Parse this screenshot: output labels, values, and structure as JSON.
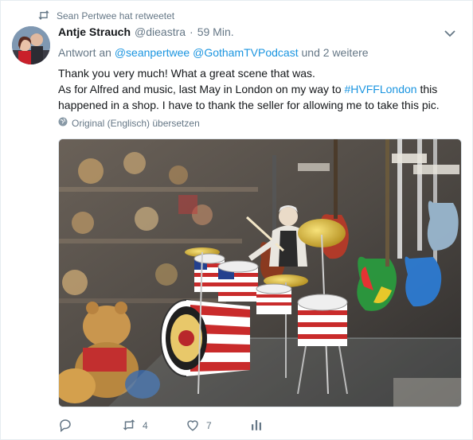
{
  "retweet_notice": "Sean Pertwee hat retweetet",
  "author": {
    "name": "Antje Strauch",
    "handle": "@diеastra",
    "separator": "·",
    "time": "59 Min."
  },
  "reply_context": {
    "prefix": "Antwort an",
    "mention1": "@seanpertwee",
    "mention2": "@GothamTVPodcast",
    "suffix": "und 2 weitere"
  },
  "body": {
    "line1": "Thank you very much! What a great scene that was.",
    "line2_pre": "As for Alfred and music, last May in London on my way to ",
    "hashtag": "#HVFFLondon",
    "line2_post": " this happened in a shop. I have to thank the seller for allowing me to take this pic."
  },
  "translate_label": "Original (Englisch) übersetzen",
  "actions": {
    "retweet_count": "4",
    "like_count": "7"
  },
  "colors": {
    "link": "#1b95e0",
    "secondary_text": "#657786",
    "border": "#e6ecf0"
  },
  "icons": [
    "retweet-icon",
    "avatar",
    "chevron-down-icon",
    "globe-icon",
    "reply-icon",
    "retweet-icon",
    "heart-icon",
    "analytics-icon"
  ]
}
